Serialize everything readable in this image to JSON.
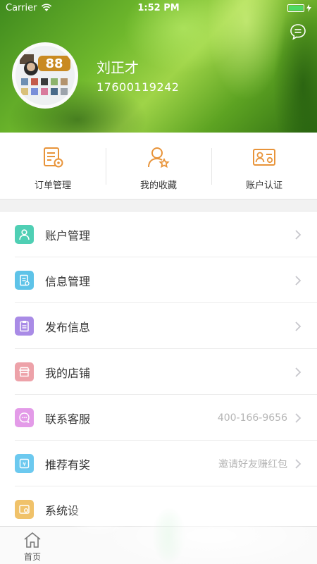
{
  "status": {
    "carrier": "Carrier",
    "time": "1:52 PM",
    "battery_level": 1.0
  },
  "profile": {
    "name": "刘正才",
    "phone": "17600119242",
    "avatar_text": "88"
  },
  "quick_actions": [
    {
      "label": "订单管理",
      "icon": "order-manage-icon"
    },
    {
      "label": "我的收藏",
      "icon": "favorites-icon"
    },
    {
      "label": "账户认证",
      "icon": "account-verify-icon"
    }
  ],
  "menu": [
    {
      "label": "账户管理",
      "value": "",
      "icon": "account-icon",
      "color": "#4fcfb4"
    },
    {
      "label": "信息管理",
      "value": "",
      "icon": "info-icon",
      "color": "#5ec3e8"
    },
    {
      "label": "发布信息",
      "value": "",
      "icon": "publish-icon",
      "color": "#a98be6"
    },
    {
      "label": "我的店铺",
      "value": "",
      "icon": "shop-icon",
      "color": "#eda2a9"
    },
    {
      "label": "联系客服",
      "value": "400-166-9656",
      "icon": "service-icon",
      "color": "#e39be8"
    },
    {
      "label": "推荐有奖",
      "value": "邀请好友赚红包",
      "icon": "reward-icon",
      "color": "#6cc9ef"
    },
    {
      "label": "系统设",
      "value": "",
      "icon": "settings-icon",
      "color": "#f0c26a"
    }
  ],
  "tab_bar": {
    "home_label": "首页"
  },
  "colors": {
    "accent": "#e8943a",
    "chevron": "#c7c7cc"
  }
}
